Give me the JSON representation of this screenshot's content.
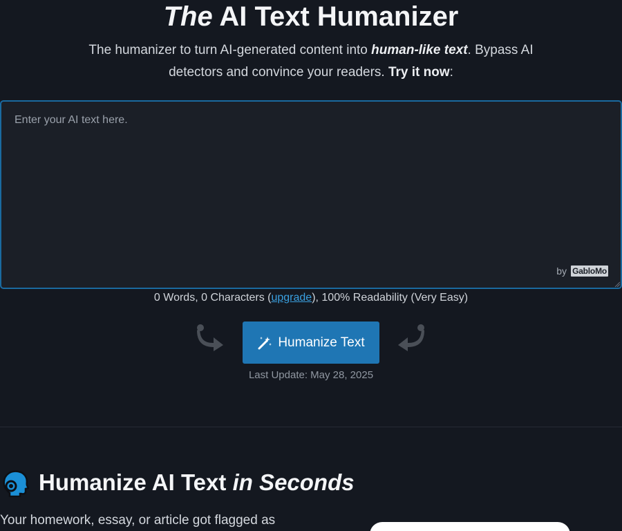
{
  "header": {
    "title_em": "The",
    "title_rest": " AI Text Humanizer",
    "subtitle_part1": "The humanizer to turn AI-generated content into ",
    "subtitle_em": "human-like text",
    "subtitle_part2": ". Bypass AI detectors and convince your readers. ",
    "subtitle_bold": "Try it now",
    "subtitle_end": ":"
  },
  "editor": {
    "placeholder": "Enter your AI text here.",
    "value": "",
    "by_label": "by",
    "brand": "GabloMo"
  },
  "stats": {
    "words": "0 Words, 0 Characters (",
    "upgrade_link": "upgrade",
    "rest": "), 100% Readability (Very Easy)"
  },
  "actions": {
    "humanize_label": "Humanize Text",
    "last_update": "Last Update: May 28, 2025"
  },
  "section": {
    "title_main": "Humanize AI Text ",
    "title_em": "in Seconds",
    "text": "Your homework, essay, or article got flagged as"
  },
  "icons": {
    "left_arrow": "curved-arrow-right-icon",
    "right_arrow": "curved-arrow-left-icon",
    "button_icon": "magic-wand-icon",
    "section_icon": "head-icon"
  },
  "colors": {
    "background": "#141820",
    "accent": "#1f76b4",
    "editor_border": "#1a6aa0",
    "link": "#3aa0e0"
  }
}
